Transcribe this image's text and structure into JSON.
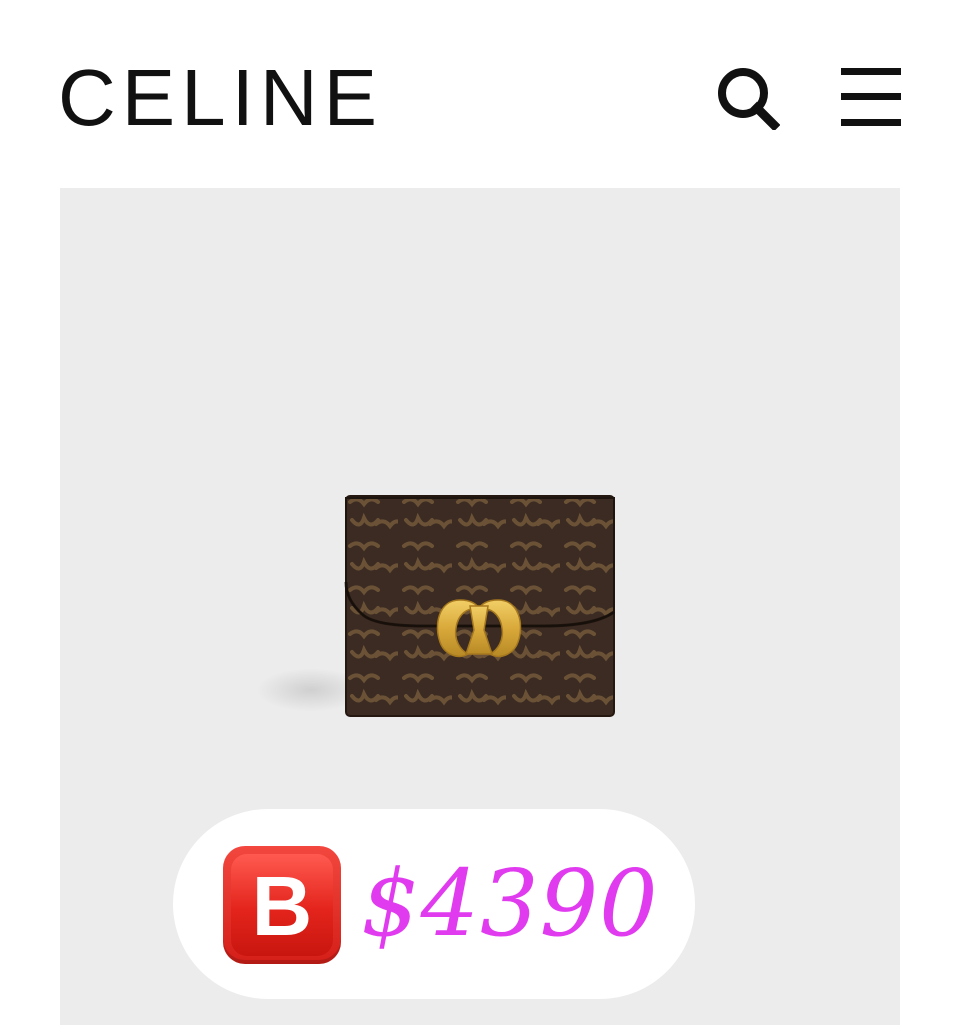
{
  "header": {
    "brand": "CELINE",
    "search_icon": "search-icon",
    "menu_icon": "hamburger-menu-icon"
  },
  "product": {
    "image": "triomphe-wallet-image",
    "badge_letter": "B",
    "price": "$4390"
  },
  "colors": {
    "brand_text": "#111111",
    "panel_bg": "#ececec",
    "price_text": "#e13bf0",
    "badge_red": "#e3241c",
    "wallet_brown": "#3a2a20",
    "clasp_gold": "#d4a637"
  }
}
